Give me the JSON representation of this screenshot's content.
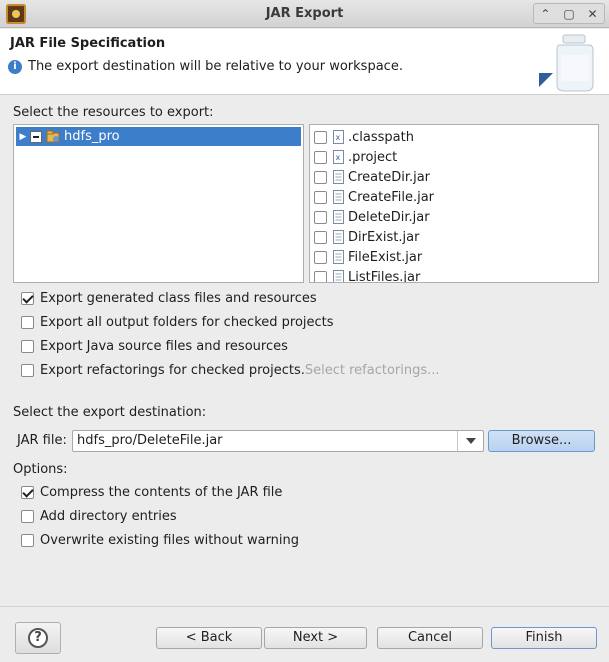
{
  "window": {
    "title": "JAR Export",
    "controls": [
      "⌃",
      "▢",
      "✕"
    ]
  },
  "header": {
    "title": "JAR File Specification",
    "info": "The export destination will be relative to your workspace."
  },
  "resources": {
    "label": "Select the resources to export:",
    "tree": [
      {
        "label": "hdfs_pro",
        "expanded": false,
        "selected": true,
        "check_state": "partial"
      }
    ],
    "files": [
      {
        "name": ".classpath",
        "icon": "xml-file-icon",
        "checked": false
      },
      {
        "name": ".project",
        "icon": "xml-file-icon",
        "checked": false
      },
      {
        "name": "CreateDir.jar",
        "icon": "text-file-icon",
        "checked": false
      },
      {
        "name": "CreateFile.jar",
        "icon": "text-file-icon",
        "checked": false
      },
      {
        "name": "DeleteDir.jar",
        "icon": "text-file-icon",
        "checked": false
      },
      {
        "name": "DirExist.jar",
        "icon": "text-file-icon",
        "checked": false
      },
      {
        "name": "FileExist.jar",
        "icon": "text-file-icon",
        "checked": false
      },
      {
        "name": "ListFiles.jar",
        "icon": "text-file-icon",
        "checked": false
      }
    ]
  },
  "export_options": [
    {
      "label": "Export generated class files and resources",
      "checked": true
    },
    {
      "label": "Export all output folders for checked projects",
      "checked": false
    },
    {
      "label": "Export Java source files and resources",
      "checked": false
    },
    {
      "label": "Export refactorings for checked projects.",
      "checked": false,
      "link": "Select refactorings..."
    }
  ],
  "destination": {
    "label": "Select the export destination:",
    "jar_label": "JAR file:",
    "jar_value": "hdfs_pro/DeleteFile.jar",
    "browse": "Browse..."
  },
  "options": {
    "label": "Options:",
    "items": [
      {
        "label": "Compress the contents of the JAR file",
        "checked": true
      },
      {
        "label": "Add directory entries",
        "checked": false
      },
      {
        "label": "Overwrite existing files without warning",
        "checked": false
      }
    ]
  },
  "footer": {
    "help": "?",
    "back": "< Back",
    "next": "Next >",
    "cancel": "Cancel",
    "finish": "Finish"
  },
  "colors": {
    "selection": "#3d7ecb",
    "accent_border": "#6b98cf",
    "link_disabled": "#a6a6a6"
  }
}
